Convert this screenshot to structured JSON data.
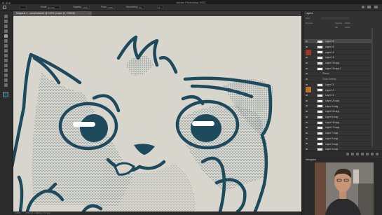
{
  "window": {
    "title": "Adobe Photoshop 2020"
  },
  "options_bar": {
    "mode_label": "Mode:",
    "mode_value": "Normal",
    "opacity_label": "Opacity:",
    "opacity_value": "100%",
    "flow_label": "Flow:",
    "flow_value": "100%",
    "smoothing_label": "Smoothing:",
    "smoothing_value": "0%",
    "angle_value": "0°"
  },
  "document_tab": {
    "label": "Magnets 1 - peopleatwork @ 100% (Layer 11, RGB/8)"
  },
  "status_bar": {
    "zoom": "100%",
    "doc": "2711 px x 1803 px (72 ppi)"
  },
  "layers_panel": {
    "tab_label": "Layers",
    "kind_label": "Kind",
    "blend_label": "Normal",
    "opacity_label": "Opacity:",
    "opacity_value": "100%",
    "fill_label": "Fill:",
    "fill_value": "100%",
    "layers": [
      {
        "name": "Layer 11",
        "type": "layer",
        "selected": true
      },
      {
        "name": "Layer 16",
        "type": "layer"
      },
      {
        "name": "Layer 14",
        "type": "layer"
      },
      {
        "name": "Layer 15",
        "type": "layer"
      },
      {
        "name": "Layer 19 copy",
        "type": "layer"
      },
      {
        "name": "Layer 19 copy 2",
        "type": "layer"
      },
      {
        "name": "Effects",
        "type": "fx"
      },
      {
        "name": "Color Overlay",
        "type": "fx"
      },
      {
        "name": "Layer 12",
        "type": "layer"
      },
      {
        "name": "Layer 10",
        "type": "layer"
      },
      {
        "name": "Layer 13",
        "type": "layer"
      },
      {
        "name": "Layer 14 copy",
        "type": "layer"
      },
      {
        "name": "Layer 9 copy",
        "type": "layer"
      },
      {
        "name": "Layer 16 copy",
        "type": "layer"
      },
      {
        "name": "Layer 8 copy",
        "type": "layer"
      },
      {
        "name": "Layer 18 copy",
        "type": "layer"
      },
      {
        "name": "Layer 17 copy",
        "type": "layer"
      },
      {
        "name": "Layer 7 copy",
        "type": "layer"
      },
      {
        "name": "Layer 9 copy",
        "type": "layer"
      },
      {
        "name": "Layer 3 copy",
        "type": "layer"
      },
      {
        "name": "Layer 4 copy",
        "type": "layer"
      },
      {
        "name": "Layer 2 copy",
        "type": "layer"
      }
    ]
  },
  "navigator_panel": {
    "label": "Navigator"
  },
  "colors": {
    "accent_red": "#9c3a2a",
    "accent_orange": "#b8742a",
    "line_blue": "#1d4a5c",
    "canvas_bg": "#d8d5cd"
  }
}
